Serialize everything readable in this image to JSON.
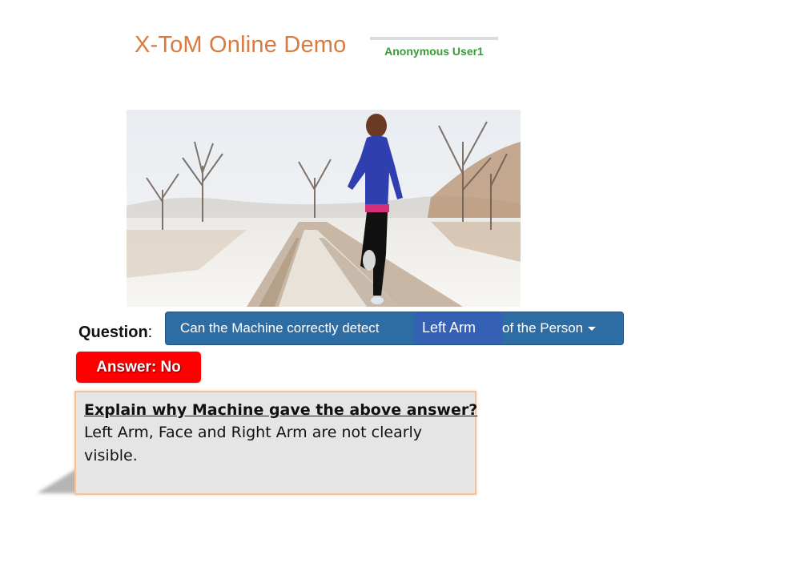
{
  "header": {
    "title": "X-ToM Online Demo",
    "user": "Anonymous User1"
  },
  "image": {
    "subject": "runner on snowy road"
  },
  "question": {
    "label": "Question",
    "prefix": "Can the Machine correctly detect",
    "selected": "Left Arm",
    "suffix": "of the Person"
  },
  "answer": {
    "text": "Answer: No"
  },
  "explanation": {
    "heading": "Explain why Machine gave the above answer?",
    "body": "Left Arm, Face and Right Arm are not clearly visible."
  },
  "colors": {
    "title": "#d97a3e",
    "user": "#3a9a3a",
    "question_bar": "#2e6da4",
    "answer_badge": "#ff0000",
    "explain_border": "#f5c29a"
  }
}
